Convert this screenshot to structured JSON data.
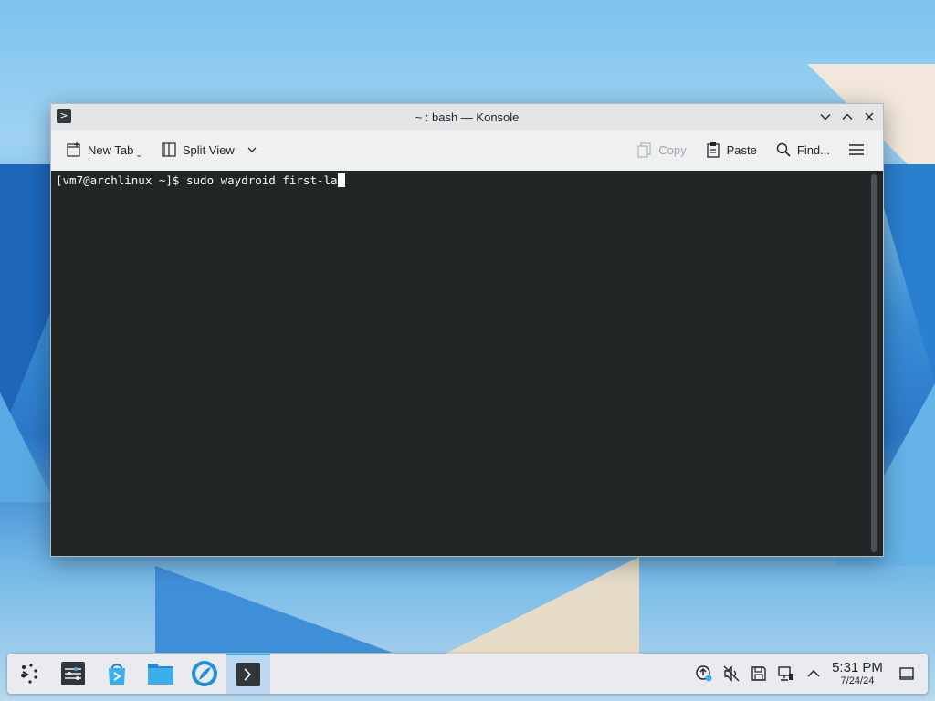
{
  "window": {
    "title": "~ : bash — Konsole",
    "app_icon_glyph": ">",
    "controls": [
      "minimize-icon",
      "maximize-icon",
      "close-icon"
    ]
  },
  "toolbar": {
    "new_tab_label": "New Tab",
    "split_view_label": "Split View",
    "copy_label": "Copy",
    "paste_label": "Paste",
    "find_label": "Find..."
  },
  "terminal": {
    "prompt": "[vm7@archlinux ~]$ ",
    "command": "sudo waydroid first-la",
    "background": "#232627",
    "foreground": "#fcfcfc"
  },
  "taskbar": {
    "apps": [
      {
        "name": "app-launcher-icon"
      },
      {
        "name": "system-settings-icon"
      },
      {
        "name": "discover-store-icon"
      },
      {
        "name": "file-manager-icon"
      },
      {
        "name": "web-browser-icon"
      },
      {
        "name": "konsole-icon",
        "active": true
      }
    ],
    "tray": [
      "update-notifier-icon",
      "volume-muted-icon",
      "disks-icon",
      "network-wired-icon",
      "show-hidden-icons-chevron-icon"
    ],
    "clock": {
      "time": "5:31 PM",
      "date": "7/24/24"
    },
    "accent": "#3daee9"
  }
}
